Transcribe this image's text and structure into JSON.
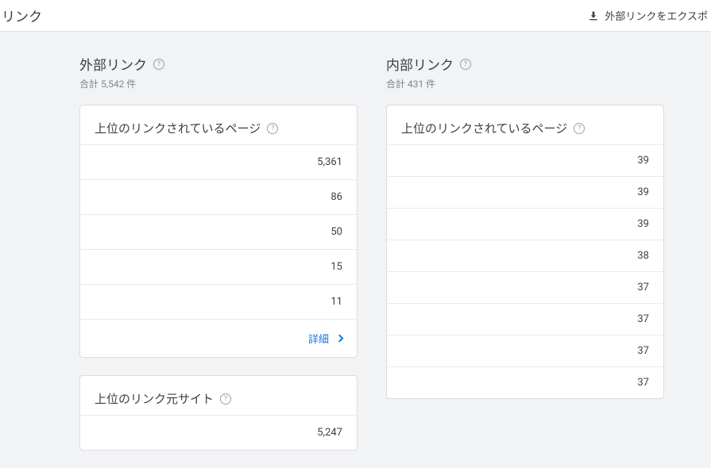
{
  "header": {
    "title": "リンク",
    "export_label": "外部リンクをエクスポ"
  },
  "external": {
    "title": "外部リンク",
    "subtitle": "合計 5,542 件",
    "top_pages": {
      "title": "上位のリンクされているページ",
      "rows": [
        "5,361",
        "86",
        "50",
        "15",
        "11"
      ],
      "more_label": "詳細"
    },
    "top_sites": {
      "title": "上位のリンク元サイト",
      "rows": [
        "5,247"
      ]
    }
  },
  "internal": {
    "title": "内部リンク",
    "subtitle": "合計 431 件",
    "top_pages": {
      "title": "上位のリンクされているページ",
      "rows": [
        "39",
        "39",
        "39",
        "38",
        "37",
        "37",
        "37",
        "37"
      ]
    }
  }
}
